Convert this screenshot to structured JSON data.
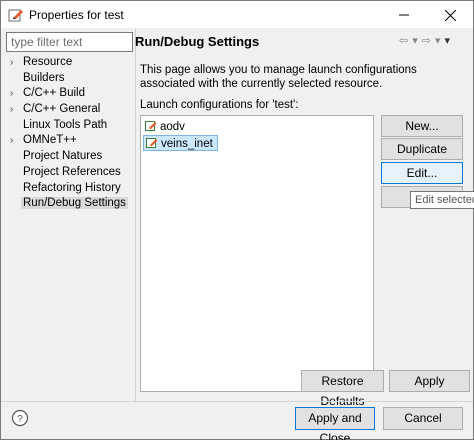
{
  "window": {
    "title": "Properties for test"
  },
  "filter": {
    "placeholder": "type filter text"
  },
  "tree": [
    {
      "label": "Resource",
      "expandable": true
    },
    {
      "label": "Builders",
      "expandable": false
    },
    {
      "label": "C/C++ Build",
      "expandable": true
    },
    {
      "label": "C/C++ General",
      "expandable": true
    },
    {
      "label": "Linux Tools Path",
      "expandable": false
    },
    {
      "label": "OMNeT++",
      "expandable": true
    },
    {
      "label": "Project Natures",
      "expandable": false
    },
    {
      "label": "Project References",
      "expandable": false
    },
    {
      "label": "Refactoring History",
      "expandable": false
    },
    {
      "label": "Run/Debug Settings",
      "expandable": false,
      "selected": true
    }
  ],
  "page": {
    "title": "Run/Debug Settings",
    "description": "This page allows you to manage launch configurations associated with the currently selected resource.",
    "list_label": "Launch configurations for 'test':",
    "configs": [
      {
        "label": "aodv",
        "selected": false
      },
      {
        "label": "veins_inet",
        "selected": true
      }
    ]
  },
  "buttons": {
    "new": "New...",
    "duplicate": "Duplicate",
    "edit": "Edit...",
    "delete": "",
    "restore_defaults": "Restore Defaults",
    "apply": "Apply",
    "apply_and_close": "Apply and Close",
    "cancel": "Cancel"
  },
  "tooltip": "Edit selected",
  "colors": {
    "accent": "#0078d7",
    "selection_bg": "#cce8ff",
    "icon_pen": "#e05a2a",
    "icon_frame": "#3a7d3a"
  }
}
